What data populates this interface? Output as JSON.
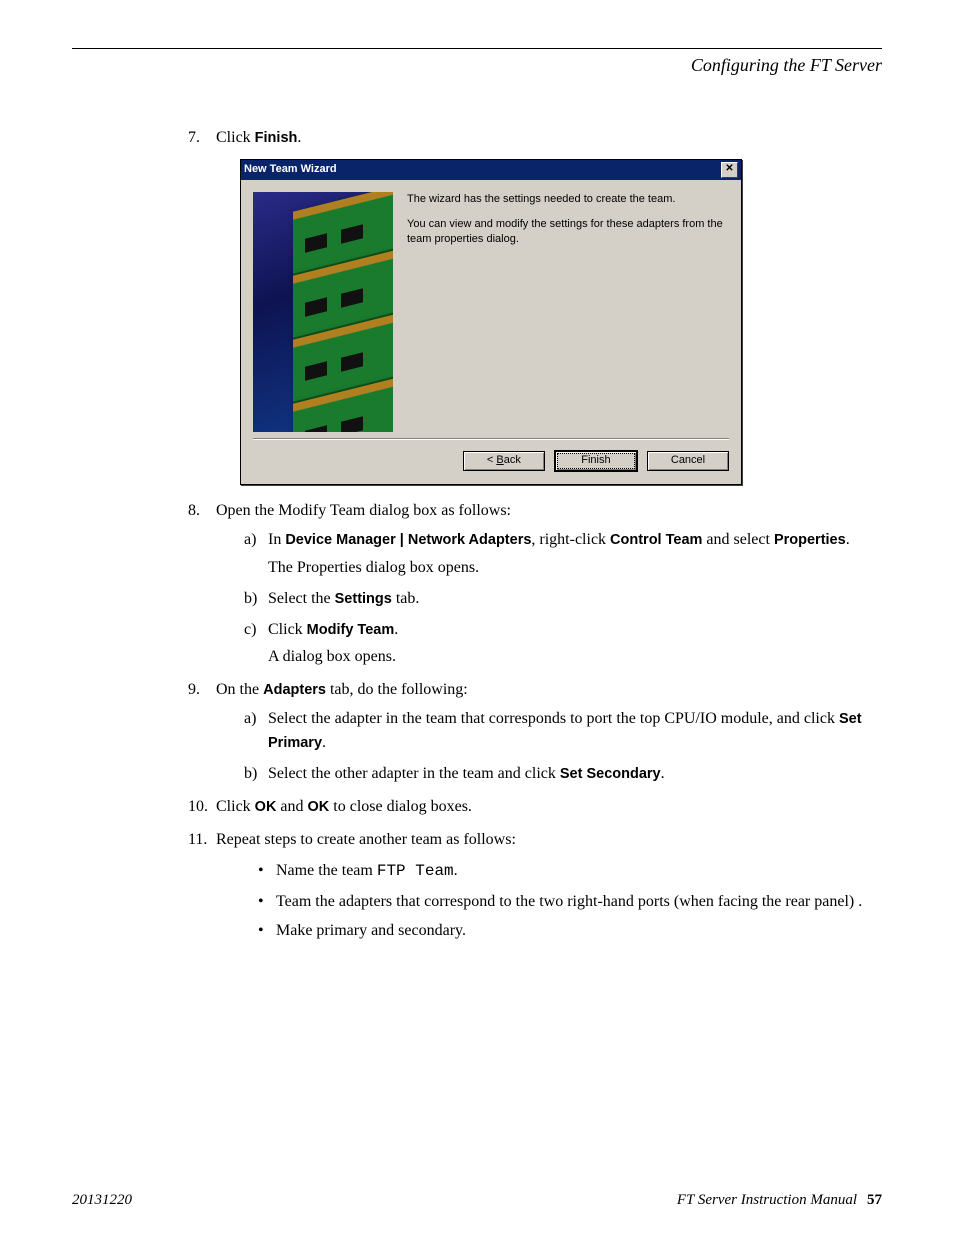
{
  "header": {
    "title": "Configuring the FT Server"
  },
  "steps": {
    "s7": {
      "num": "7.",
      "pre": "Click ",
      "bold": "Finish",
      "post": "."
    },
    "s8": {
      "num": "8.",
      "text": "Open the Modify Team dialog box as follows:",
      "a": {
        "subnum": "a)",
        "p1": "In ",
        "b1": "Device Manager | Network Adapters",
        "p2": ", right-click ",
        "b2": "Control Team",
        "p3": " and select ",
        "b3": "Properties",
        "p4": ".",
        "desc": "The Properties dialog box opens."
      },
      "b": {
        "subnum": "b)",
        "p1": "Select the ",
        "b1": "Settings",
        "p2": " tab."
      },
      "c": {
        "subnum": "c)",
        "p1": "Click ",
        "b1": "Modify Team",
        "p2": ".",
        "desc": "A dialog box opens."
      }
    },
    "s9": {
      "num": "9.",
      "p1": "On the ",
      "b1": "Adapters",
      "p2": " tab, do the following:",
      "a": {
        "subnum": "a)",
        "p1": "Select the adapter in the team that corresponds to port the top CPU/IO module, and click ",
        "b1": "Set Primary",
        "p2": "."
      },
      "b": {
        "subnum": "b)",
        "p1": "Select the other adapter in the team and click ",
        "b1": "Set Secondary",
        "p2": "."
      }
    },
    "s10": {
      "num": "10.",
      "p1": "Click ",
      "b1": "OK",
      "p2": " and ",
      "b2": "OK",
      "p3": " to close dialog boxes."
    },
    "s11": {
      "num": "11.",
      "text": "Repeat steps to create another team as follows:",
      "u1": {
        "p1": "Name the team ",
        "mono": "FTP Team",
        "p2": "."
      },
      "u2": "Team the adapters that correspond to the two right-hand ports (when facing the rear panel) .",
      "u3": "Make primary and secondary."
    }
  },
  "dialog": {
    "title": "New Team Wizard",
    "line1": "The wizard has the settings needed to create the team.",
    "line2": "You can view and modify the settings for these adapters from the team properties dialog.",
    "back_prefix": "< ",
    "back_u": "B",
    "back_rest": "ack",
    "finish": "Finish",
    "cancel": "Cancel",
    "close_glyph": "✕"
  },
  "footer": {
    "date": "20131220",
    "manual": "FT Server Instruction Manual",
    "page": "57"
  }
}
